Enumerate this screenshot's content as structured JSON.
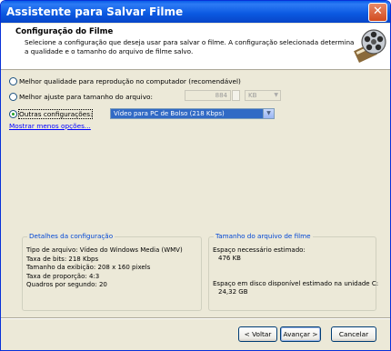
{
  "window": {
    "title": "Assistente para Salvar Filme",
    "close_glyph": "✕"
  },
  "header": {
    "title": "Configuração do Filme",
    "description_line1": "Selecione a configuração que deseja usar para salvar o filme. A configuração selecionada determina",
    "description_line2": "a qualidade e o tamanho do arquivo de filme salvo.",
    "icon": "film-reel-icon"
  },
  "options": [
    {
      "label": "Melhor qualidade para reprodução no computador (recomendável)",
      "checked": false
    },
    {
      "label": "Melhor ajuste para tamanho do arquivo:",
      "checked": false
    },
    {
      "label": "Outras configurações:",
      "checked": true
    }
  ],
  "file_size": {
    "value": "884",
    "unit": "KB"
  },
  "other_settings": {
    "selected": "Vídeo para PC de Bolso (218 Kbps)"
  },
  "show_less_link": "Mostrar menos opções...",
  "details": {
    "title": "Detalhes da configuração",
    "lines": [
      "Tipo de arquivo: Vídeo do Windows Media (WMV)",
      "Taxa de bits: 218 Kbps",
      "Tamanho da exibição: 208 x 160 pixels",
      "Taxa de proporção: 4:3",
      "Quadros por segundo: 20"
    ]
  },
  "file_size_group": {
    "title": "Tamanho do arquivo de filme",
    "estimated_label": "Espaço necessário estimado:",
    "estimated_value": "476 KB",
    "disk_label": "Espaço em disco disponível estimado na unidade C:",
    "disk_value": "24,32 GB"
  },
  "buttons": {
    "back": "< Voltar",
    "next": "Avançar >",
    "cancel": "Cancelar"
  },
  "colors": {
    "title_bar": "#0a58e0",
    "selection": "#316ac5",
    "group_title": "#0046d5",
    "link": "#0000ff"
  }
}
